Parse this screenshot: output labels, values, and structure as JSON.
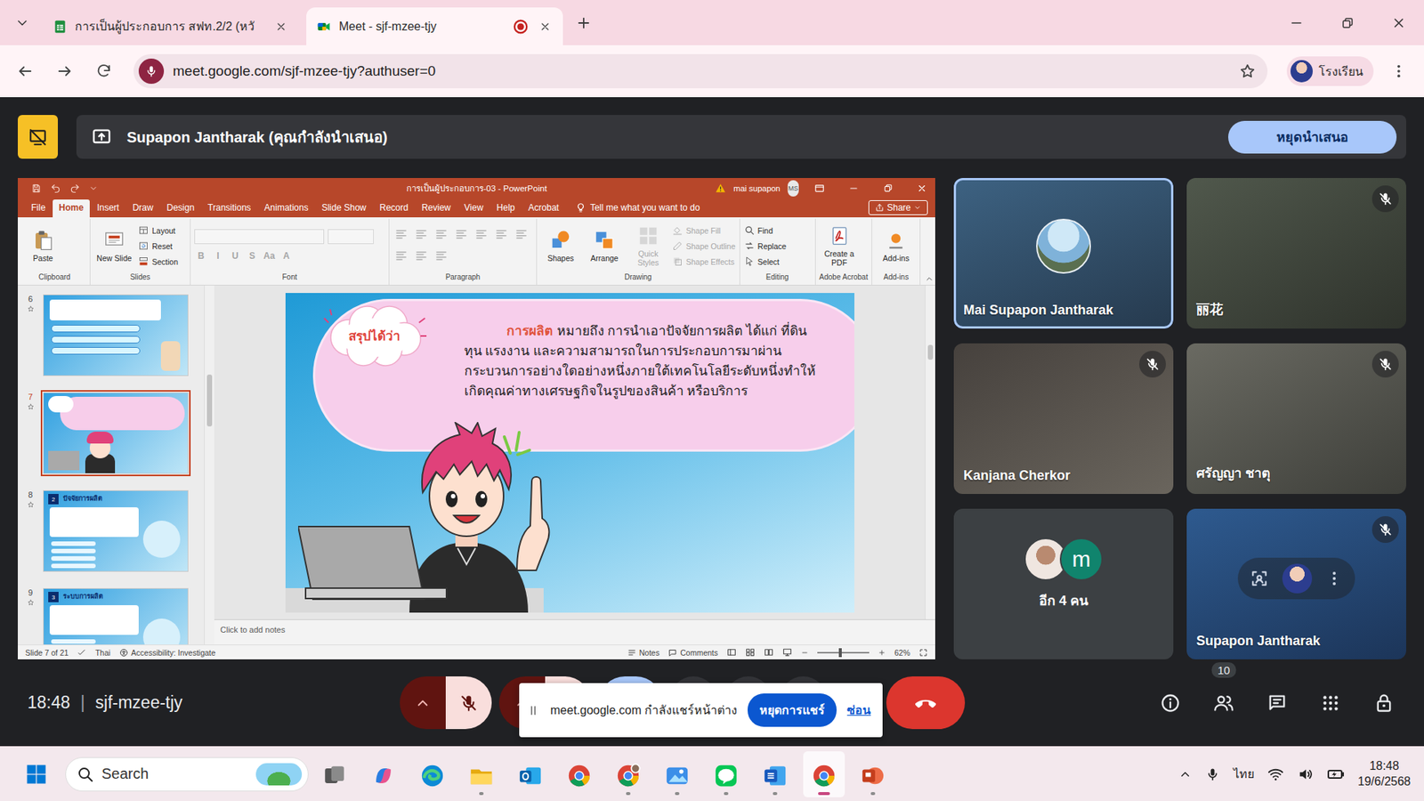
{
  "browser": {
    "tabs": [
      {
        "label": "การเป็นผู้ประกอบการ สฟท.2/2 (หวั",
        "kind": "sheets",
        "selected": false,
        "recording": false
      },
      {
        "label": "Meet - sjf-mzee-tjy",
        "kind": "meet",
        "selected": true,
        "recording": true
      }
    ],
    "url": "meet.google.com/sjf-mzee-tjy?authuser=0",
    "profile": "โรงเรียน"
  },
  "presenting": {
    "label": "Supapon Jantharak (คุณกำลังนำเสนอ)",
    "stop_button": "หยุดนำเสนอ"
  },
  "powerpoint": {
    "title": "การเป็นผู้ประกอบการ-03 - PowerPoint",
    "user": "mai supapon",
    "initials": "MS",
    "tabs": [
      {
        "label": "File",
        "selected": false
      },
      {
        "label": "Home",
        "selected": true
      },
      {
        "label": "Insert",
        "selected": false
      },
      {
        "label": "Draw",
        "selected": false
      },
      {
        "label": "Design",
        "selected": false
      },
      {
        "label": "Transitions",
        "selected": false
      },
      {
        "label": "Animations",
        "selected": false
      },
      {
        "label": "Slide Show",
        "selected": false
      },
      {
        "label": "Record",
        "selected": false
      },
      {
        "label": "Review",
        "selected": false
      },
      {
        "label": "View",
        "selected": false
      },
      {
        "label": "Help",
        "selected": false
      },
      {
        "label": "Acrobat",
        "selected": false
      }
    ],
    "tell_me": "Tell me what you want to do",
    "share": "Share",
    "groups": [
      {
        "label": "Clipboard",
        "items": [
          {
            "label": "Paste",
            "kind": "large",
            "disabled": false
          }
        ]
      },
      {
        "label": "Slides",
        "items": [
          {
            "label": "New Slide",
            "kind": "large",
            "disabled": false
          },
          {
            "label": "Layout",
            "kind": "small",
            "disabled": false
          },
          {
            "label": "Reset",
            "kind": "small",
            "disabled": false
          },
          {
            "label": "Section",
            "kind": "small",
            "disabled": false
          }
        ]
      },
      {
        "label": "Font",
        "items": [
          {
            "kind": "field",
            "disabled": true
          },
          {
            "kind": "field",
            "disabled": true
          },
          {
            "label": "B",
            "kind": "glyph",
            "disabled": true
          },
          {
            "label": "I",
            "kind": "glyph",
            "disabled": true
          },
          {
            "label": "U",
            "kind": "glyph",
            "disabled": true
          },
          {
            "label": "S",
            "kind": "glyph",
            "disabled": true
          },
          {
            "label": "Aa",
            "kind": "glyph",
            "disabled": true
          },
          {
            "label": "A",
            "kind": "glyph",
            "disabled": true
          }
        ]
      },
      {
        "label": "Paragraph",
        "items": [
          {
            "kind": "tool",
            "disabled": true
          },
          {
            "kind": "tool",
            "disabled": true
          },
          {
            "kind": "tool",
            "disabled": true
          },
          {
            "kind": "tool",
            "disabled": true
          },
          {
            "kind": "tool",
            "disabled": true
          },
          {
            "kind": "tool",
            "disabled": true
          },
          {
            "kind": "tool",
            "disabled": true
          },
          {
            "kind": "tool",
            "disabled": true
          },
          {
            "kind": "tool",
            "disabled": true
          },
          {
            "kind": "tool",
            "disabled": true
          }
        ]
      },
      {
        "label": "Drawing",
        "items": [
          {
            "label": "Shapes",
            "kind": "large",
            "disabled": false
          },
          {
            "label": "Arrange",
            "kind": "large",
            "disabled": false
          },
          {
            "label": "Quick Styles",
            "kind": "large",
            "disabled": true
          },
          {
            "label": "Shape Fill",
            "kind": "small",
            "disabled": true
          },
          {
            "label": "Shape Outline",
            "kind": "small",
            "disabled": true
          },
          {
            "label": "Shape Effects",
            "kind": "small",
            "disabled": true
          }
        ]
      },
      {
        "label": "Editing",
        "items": [
          {
            "label": "Find",
            "kind": "small",
            "disabled": false
          },
          {
            "label": "Replace",
            "kind": "small",
            "disabled": false
          },
          {
            "label": "Select",
            "kind": "small",
            "disabled": false
          }
        ]
      },
      {
        "label": "Adobe Acrobat",
        "items": [
          {
            "label": "Create a PDF",
            "kind": "large",
            "disabled": false
          }
        ]
      },
      {
        "label": "Add-ins",
        "items": [
          {
            "label": "Add-ins",
            "kind": "large",
            "disabled": false
          }
        ]
      }
    ],
    "thumbnails": [
      {
        "number": "6",
        "kind": "list",
        "selected": false
      },
      {
        "number": "7",
        "kind": "bubble",
        "selected": true
      },
      {
        "number": "8",
        "kind": "title",
        "selected": false,
        "badge": "2",
        "title": "ปัจจัยการผลิต"
      },
      {
        "number": "9",
        "kind": "title",
        "selected": false,
        "badge": "3",
        "title": "ระบบการผลิต"
      }
    ],
    "slide": {
      "cloud": "สรุปได้ว่า",
      "term": "การผลิต",
      "definition": "หมายถึง การนำเอาปัจจัยการผลิต ได้แก่ ที่ดิน ทุน แรงงาน และความสามารถในการประกอบการมาผ่านกระบวนการอย่างใดอย่างหนึ่งภายใต้เทคโนโลยีระดับหนึ่งทำให้เกิดคุณค่าทางเศรษฐกิจในรูปของสินค้า หรือบริการ"
    },
    "notes_placeholder": "Click to add notes",
    "status": {
      "slide": "Slide 7 of 21",
      "language": "Thai",
      "accessibility": "Accessibility: Investigate",
      "notes": "Notes",
      "comments": "Comments",
      "zoom": "62%",
      "zoom_level": 0.45
    }
  },
  "participants": [
    {
      "name": "Mai Supapon Jantharak",
      "kind": "avatar",
      "muted": false,
      "highlighted": true
    },
    {
      "name": "丽花",
      "kind": "video",
      "muted": true,
      "highlighted": false
    },
    {
      "name": "Kanjana Cherkor",
      "kind": "video",
      "muted": true,
      "highlighted": false
    },
    {
      "name": "ศรัญญา ชาตุ",
      "kind": "video",
      "muted": true,
      "highlighted": false
    },
    {
      "name": "อีก 4 คน",
      "kind": "group",
      "muted": false,
      "highlighted": false,
      "initial": "m"
    },
    {
      "name": "Supapon Jantharak",
      "kind": "self",
      "muted": true,
      "highlighted": false
    }
  ],
  "call_bar": {
    "time": "18:48",
    "separator": "|",
    "code": "sjf-mzee-tjy",
    "mic_muted": true,
    "people_count": "10",
    "share_notice": {
      "text": "meet.google.com กำลังแชร์หน้าต่าง",
      "stop": "หยุดการแชร์",
      "hide": "ซ่อน"
    }
  },
  "taskbar": {
    "search": "Search",
    "apps": [
      {
        "kind": "taskview",
        "running": false,
        "active": false
      },
      {
        "kind": "copilot",
        "running": false,
        "active": false
      },
      {
        "kind": "edge",
        "running": false,
        "active": false
      },
      {
        "kind": "explorer",
        "running": true,
        "active": false
      },
      {
        "kind": "outlook",
        "running": false,
        "active": false
      },
      {
        "kind": "chrome",
        "running": false,
        "active": false
      },
      {
        "kind": "chromeprofile",
        "running": true,
        "active": false
      },
      {
        "kind": "photos",
        "running": true,
        "active": false
      },
      {
        "kind": "line",
        "running": true,
        "active": false
      },
      {
        "kind": "word",
        "running": true,
        "active": false
      },
      {
        "kind": "chrome",
        "running": true,
        "active": true
      },
      {
        "kind": "powerpoint",
        "running": true,
        "active": false
      }
    ],
    "language": "ไทย",
    "time": "18:48",
    "date": "19/6/2568"
  }
}
